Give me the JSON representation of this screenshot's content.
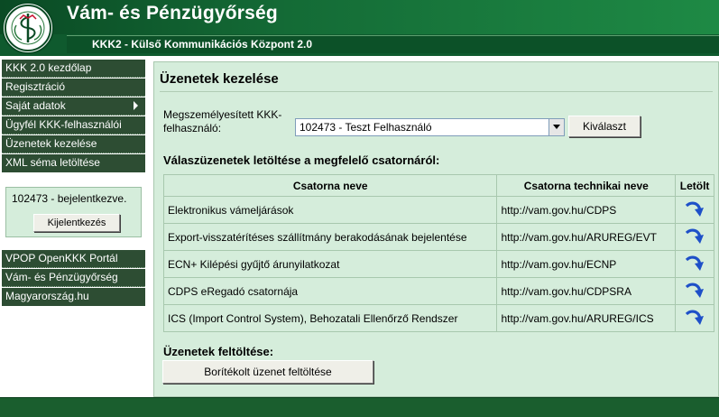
{
  "header": {
    "title": "Vám- és Pénzügyőrség",
    "subtitle": "KKK2 - Külső Kommunikációs Központ 2.0"
  },
  "sidebar": {
    "items": [
      {
        "label": "KKK 2.0 kezdőlap"
      },
      {
        "label": "Regisztráció"
      },
      {
        "label": "Saját adatok"
      },
      {
        "label": "Ügyfél KKK-felhasználói"
      },
      {
        "label": "Üzenetek kezelése"
      },
      {
        "label": "XML séma letöltése"
      }
    ],
    "login": {
      "status": "102473 - bejelentkezve.",
      "logout_label": "Kijelentkezés"
    },
    "links": [
      {
        "label": "VPOP OpenKKK Portál"
      },
      {
        "label": "Vám- és Pénzügyőrség"
      },
      {
        "label": "Magyarország.hu"
      }
    ]
  },
  "main": {
    "title": "Üzenetek kezelése",
    "user_label": "Megszemélyesített KKK-felhasználó:",
    "user_selected": "102473 - Teszt Felhasználó",
    "select_button": "Kiválaszt",
    "download_title": "Válaszüzenetek letöltése a megfelelő csatornáról:",
    "table": {
      "headers": [
        "Csatorna neve",
        "Csatorna technikai neve",
        "Letölt"
      ],
      "rows": [
        {
          "name": "Elektronikus vámeljárások",
          "tech": "http://vam.gov.hu/CDPS"
        },
        {
          "name": "Export-visszatérítéses szállítmány berakodásának bejelentése",
          "tech": "http://vam.gov.hu/ARUREG/EVT"
        },
        {
          "name": "ECN+ Kilépési gyűjtő árunyilatkozat",
          "tech": "http://vam.gov.hu/ECNP"
        },
        {
          "name": "CDPS eRegadó csatornája",
          "tech": "http://vam.gov.hu/CDPSRA"
        },
        {
          "name": "ICS (Import Control System), Behozatali Ellenőrző Rendszer",
          "tech": "http://vam.gov.hu/ARUREG/ICS"
        }
      ]
    },
    "upload_title": "Üzenetek feltöltése:",
    "upload_button": "Borítékolt üzenet feltöltése"
  },
  "colors": {
    "header_green": "#0f5a2e",
    "nav_bg": "#2d4d33",
    "panel_bg": "#d5eddb",
    "download_icon": "#1e50c8"
  },
  "icons": {
    "logo": "customs-emblem-icon",
    "download": "download-arrow-icon",
    "submenu": "triangle-right-icon"
  }
}
